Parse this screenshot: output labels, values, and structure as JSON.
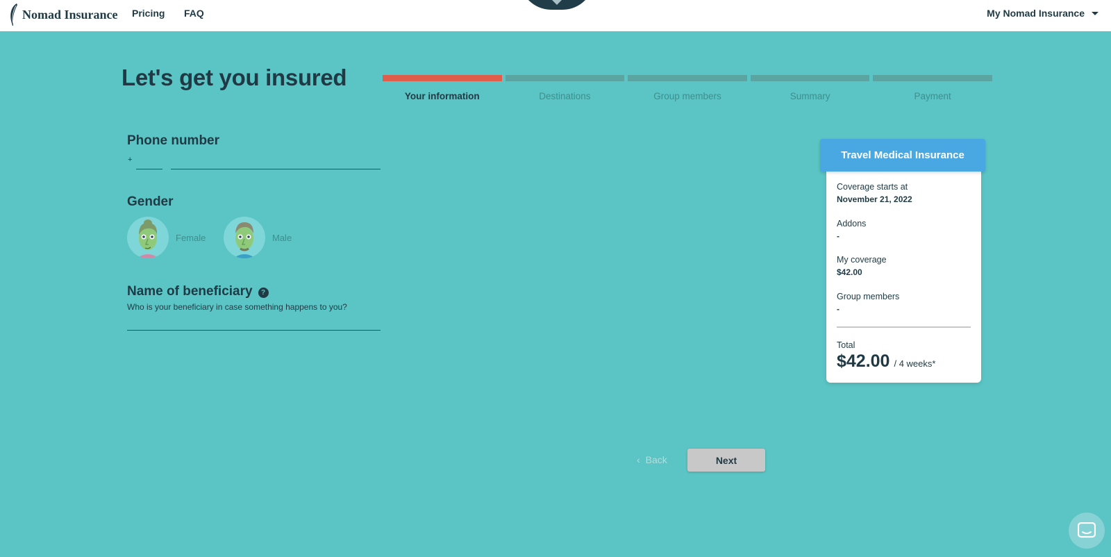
{
  "nav": {
    "brand": "Nomad Insurance",
    "links": [
      "Pricing",
      "FAQ"
    ],
    "account_menu": "My Nomad Insurance"
  },
  "page": {
    "title": "Let's get you insured"
  },
  "stepper": {
    "steps": [
      "Your information",
      "Destinations",
      "Group members",
      "Summary",
      "Payment"
    ],
    "active_index": 0
  },
  "form": {
    "phone": {
      "title": "Phone number",
      "prefix": "+",
      "country_code_value": "",
      "number_value": ""
    },
    "gender": {
      "title": "Gender",
      "options": [
        "Female",
        "Male"
      ]
    },
    "beneficiary": {
      "title": "Name of beneficiary",
      "help_icon": "?",
      "hint": "Who is your beneficiary in case something happens to you?",
      "value": ""
    }
  },
  "summary": {
    "header": "Travel Medical Insurance",
    "coverage_starts_label": "Coverage starts at",
    "coverage_starts_value": "November 21, 2022",
    "addons_label": "Addons",
    "addons_value": "-",
    "my_coverage_label": "My coverage",
    "my_coverage_value": "$42.00",
    "group_members_label": "Group members",
    "group_members_value": "-",
    "total_label": "Total",
    "total_amount": "$42.00",
    "total_period": "/ 4 weeks*"
  },
  "actions": {
    "back": "Back",
    "next": "Next"
  },
  "icons": {
    "logo": "feather-logo-icon",
    "chat": "chat-bubble-icon",
    "back": "chevron-left-icon",
    "dropdown": "caret-down-icon"
  },
  "colors": {
    "background": "#5bc4c4",
    "accent_step": "#e05c4b",
    "card_header": "#49a8e2",
    "text_dark": "#1f3a44",
    "next_button": "#c8c8c8"
  }
}
